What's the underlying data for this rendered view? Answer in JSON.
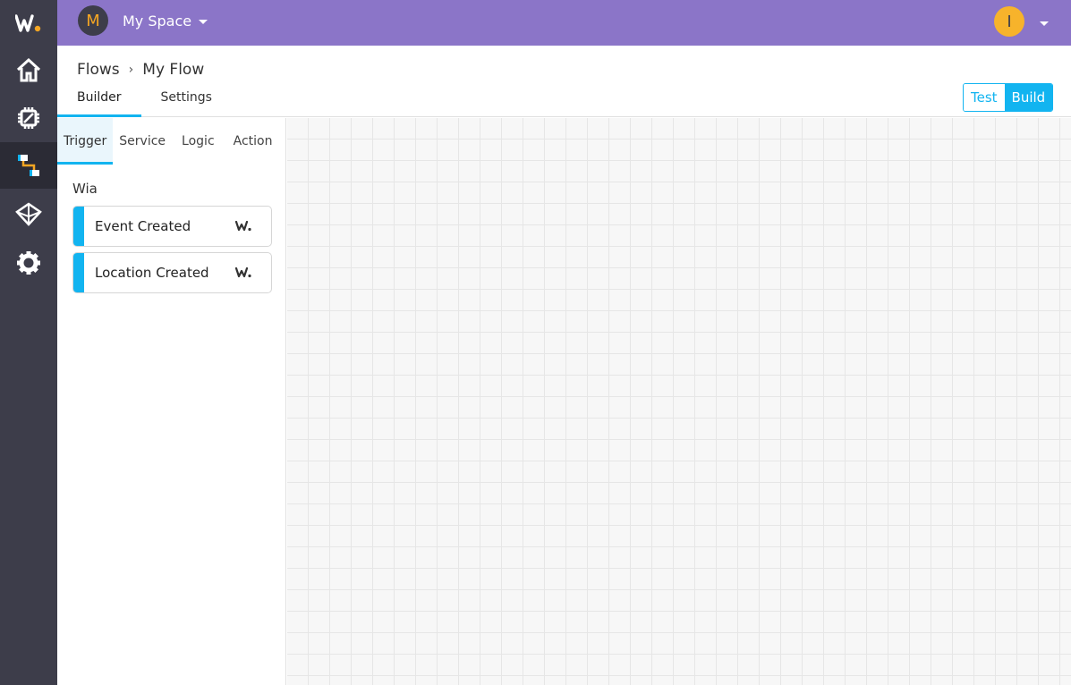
{
  "topbar": {
    "space_initial": "M",
    "space_name": "My Space",
    "user_initial": "I"
  },
  "sidebar": {
    "items": [
      {
        "icon": "home-icon"
      },
      {
        "icon": "chip-icon"
      },
      {
        "icon": "flows-icon",
        "active": true
      },
      {
        "icon": "cube-icon"
      },
      {
        "icon": "gear-icon"
      }
    ]
  },
  "breadcrumb": {
    "parent": "Flows",
    "separator": "›",
    "current": "My Flow"
  },
  "tabs": [
    "Builder",
    "Settings"
  ],
  "mode_toggle": {
    "test": "Test",
    "build": "Build"
  },
  "palette": {
    "tabs": [
      "Trigger",
      "Service",
      "Logic",
      "Action"
    ],
    "group_title": "Wia",
    "nodes": [
      {
        "label": "Event Created"
      },
      {
        "label": "Location Created"
      }
    ]
  },
  "colors": {
    "accent": "#12b4f0",
    "topbar": "#8b75c8",
    "rail": "#3d3d4a"
  }
}
